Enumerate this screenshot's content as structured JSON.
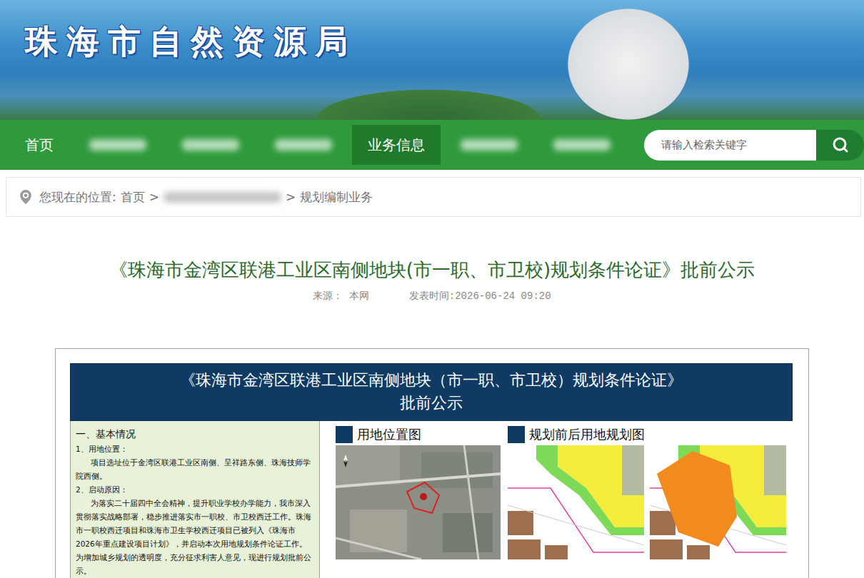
{
  "header": {
    "title": "珠海市自然资源局"
  },
  "nav": {
    "items": [
      {
        "kind": "text",
        "label": "首页",
        "selected": false
      },
      {
        "kind": "blurred",
        "selected": false
      },
      {
        "kind": "blurred",
        "selected": false
      },
      {
        "kind": "blurred",
        "selected": false
      },
      {
        "kind": "text",
        "label": "业务信息",
        "selected": true
      },
      {
        "kind": "blurred",
        "selected": false
      },
      {
        "kind": "blurred",
        "selected": false
      }
    ],
    "search": {
      "placeholder": "请输入检索关键字"
    }
  },
  "breadcrumb": {
    "label": "您现在的位置:",
    "separator": ">",
    "items": [
      {
        "kind": "text",
        "label": "首页"
      },
      {
        "kind": "blurred"
      },
      {
        "kind": "text",
        "label": "规划编制业务"
      }
    ]
  },
  "article": {
    "title": "《珠海市金湾区联港工业区南侧地块(市一职、市卫校)规划条件论证》批前公示",
    "source_label": "来源：",
    "source": "本网",
    "time": "发表时间:2026-06-24 09:20"
  },
  "notice": {
    "title": "《珠海市金湾区联港工业区南侧地块（市一职、市卫校）规划条件论证》",
    "subtitle": "批前公示",
    "section_title": "一、基本情况",
    "items": [
      {
        "heading": "1、用地位置：",
        "text": "项目选址位于金湾区联港工业区南侧、呈祥路东侧、珠海技师学院西侧。"
      },
      {
        "heading": "2、启动原因：",
        "text": "为落实二十届四中全会精神，提升职业学校办学能力，我市深入贯彻落实战略部署，稳步推进落实市一职校、市卫校西迁工作。珠海市一职校西迁项目和珠海市卫生学校西迁项目已被列入《珠海市 2026年重点建设项目计划》，并启动本次用地规划条件论证工作。为增加城乡规划的透明度，充分征求利害人意见，现进行规划批前公示。"
      }
    ],
    "figures": [
      {
        "title": "用地位置图",
        "maps": [
          {
            "kind": "satellite"
          }
        ]
      },
      {
        "title": "规划前后用地规划图",
        "maps": [
          {
            "kind": "plan-before"
          },
          {
            "kind": "plan-after"
          }
        ]
      }
    ]
  }
}
